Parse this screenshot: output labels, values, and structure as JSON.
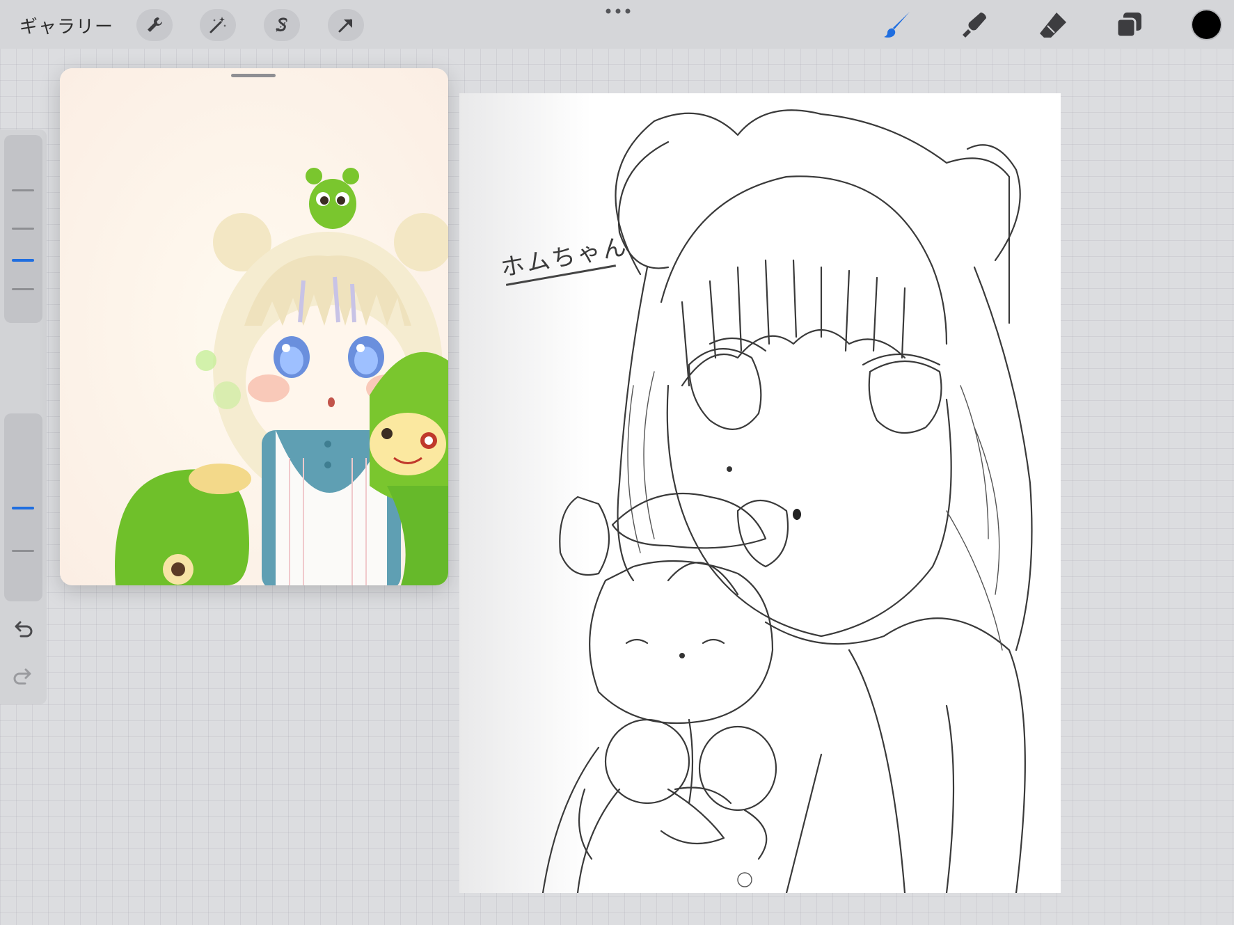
{
  "toolbar": {
    "gallery_label": "ギャラリー",
    "left_tools": [
      {
        "name": "actions",
        "icon": "wrench-icon"
      },
      {
        "name": "adjustments",
        "icon": "magic-wand-icon"
      },
      {
        "name": "selection",
        "icon": "selection-s-icon"
      },
      {
        "name": "transform",
        "icon": "arrow-cursor-icon"
      }
    ],
    "more_icon": "ellipsis-icon",
    "right_tools": [
      {
        "name": "brush",
        "icon": "brush-icon",
        "active": true
      },
      {
        "name": "smudge",
        "icon": "smudge-icon",
        "active": false
      },
      {
        "name": "eraser",
        "icon": "eraser-icon",
        "active": false
      },
      {
        "name": "layers",
        "icon": "layers-icon",
        "active": false
      }
    ],
    "current_color": "#000000",
    "active_tool_color": "#1f6ee0"
  },
  "sidebar": {
    "size_slider_icon": "size-slider",
    "opacity_slider_icon": "opacity-slider",
    "modifier_icon": "square-modifier-icon",
    "undo_icon": "undo-icon",
    "redo_icon": "redo-icon"
  },
  "reference": {
    "handle_icon": "drag-handle-icon"
  },
  "canvas": {
    "sketch_text": "ホムちゃん"
  }
}
